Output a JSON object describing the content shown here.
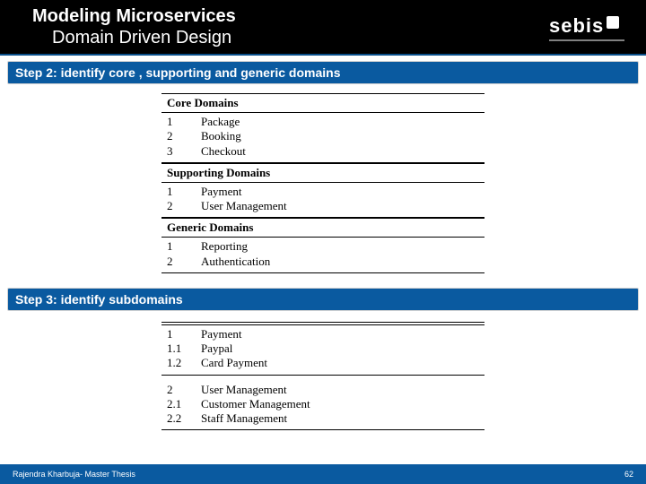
{
  "header": {
    "title": "Modeling Microservices",
    "subtitle": "Domain Driven Design",
    "logo_text": "sebis"
  },
  "steps": {
    "step2": {
      "label": "Step 2: identify core , supporting and generic domains",
      "groups": [
        {
          "title": "Core Domains",
          "items": [
            {
              "no": "1",
              "name": "Package"
            },
            {
              "no": "2",
              "name": "Booking"
            },
            {
              "no": "3",
              "name": "Checkout"
            }
          ]
        },
        {
          "title": "Supporting Domains",
          "items": [
            {
              "no": "1",
              "name": "Payment"
            },
            {
              "no": "2",
              "name": "User Management"
            }
          ]
        },
        {
          "title": "Generic Domains",
          "items": [
            {
              "no": "1",
              "name": "Reporting"
            },
            {
              "no": "2",
              "name": "Authentication"
            }
          ]
        }
      ]
    },
    "step3": {
      "label": "Step 3: identify subdomains",
      "groups": [
        {
          "title": "",
          "items": [
            {
              "no": "1",
              "name": "Payment"
            },
            {
              "no": "1.1",
              "name": "Paypal"
            },
            {
              "no": "1.2",
              "name": "Card Payment"
            }
          ]
        },
        {
          "title": "",
          "items": [
            {
              "no": "2",
              "name": "User Management"
            },
            {
              "no": "2.1",
              "name": "Customer Management"
            },
            {
              "no": "2.2",
              "name": "Staff Management"
            }
          ]
        }
      ]
    }
  },
  "footer": {
    "author": "Rajendra Kharbuja- Master Thesis",
    "page": "62"
  },
  "colors": {
    "accent": "#0a5aa0",
    "header_bg": "#000000"
  }
}
